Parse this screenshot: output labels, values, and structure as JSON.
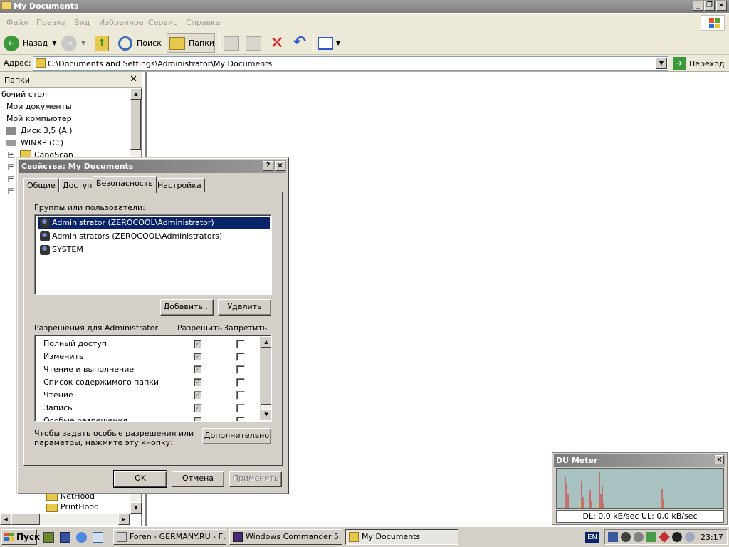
{
  "window": {
    "title": "My Documents",
    "menu": [
      "Файл",
      "Правка",
      "Вид",
      "Избранное",
      "Сервис",
      "Справка"
    ]
  },
  "toolbar": {
    "back_label": "Назад",
    "search_label": "Поиск",
    "folders_label": "Папки"
  },
  "address": {
    "label": "Адрес:",
    "path": "C:\\Documents and Settings\\Administrator\\My Documents",
    "go_label": "Переход"
  },
  "folders_pane": {
    "title": "Папки",
    "items": [
      "бочий стол",
      "Мои документы",
      "Мой компьютер",
      "Диск 3,5 (A:)",
      "WINXP (C:)",
      "CapoScan",
      "NetHood",
      "PrintHood"
    ]
  },
  "dialog": {
    "title": "Свойства: My Documents",
    "tabs": [
      "Общие",
      "Доступ",
      "Безопасность",
      "Настройка"
    ],
    "active_tab": "Безопасность",
    "groups_label": "Группы или пользователи:",
    "users": [
      {
        "name": "Administrator (ZEROCOOL\\Administrator)",
        "selected": true
      },
      {
        "name": "Administrators (ZEROCOOL\\Administrators)",
        "selected": false
      },
      {
        "name": "SYSTEM",
        "selected": false
      }
    ],
    "add_label": "Добавить...",
    "remove_label": "Удалить",
    "perms_label": "Разрешения для Administrator",
    "allow_label": "Разрешить",
    "deny_label": "Запретить",
    "permissions": [
      {
        "name": "Полный доступ",
        "allow": true,
        "deny": false
      },
      {
        "name": "Изменить",
        "allow": true,
        "deny": false
      },
      {
        "name": "Чтение и выполнение",
        "allow": true,
        "deny": false
      },
      {
        "name": "Список содержимого папки",
        "allow": true,
        "deny": false
      },
      {
        "name": "Чтение",
        "allow": true,
        "deny": false
      },
      {
        "name": "Запись",
        "allow": true,
        "deny": false
      },
      {
        "name": "Особые разрешения",
        "allow": false,
        "deny": false
      }
    ],
    "advanced_text_1": "Чтобы задать особые разрешения или",
    "advanced_text_2": "параметры, нажмите эту кнопку:",
    "advanced_label": "Дополнительно",
    "ok_label": "OK",
    "cancel_label": "Отмена",
    "apply_label": "Применить"
  },
  "du_meter": {
    "title": "DU Meter",
    "stats": "DL: 0,0 kB/sec  UL: 0,0 kB/sec"
  },
  "taskbar": {
    "start_label": "Пуск",
    "tasks": [
      {
        "label": "Foren - GERMANY.RU - Г...",
        "active": false
      },
      {
        "label": "Windows Commander 5....",
        "active": false
      },
      {
        "label": "My Documents",
        "active": true
      }
    ],
    "lang": "EN",
    "clock": "23:17"
  },
  "colors": {
    "selection": "#0a246a",
    "dialog_face": "#d4d0c8",
    "du_graph": "#a7c2c0",
    "delete_x": "#e02020"
  }
}
